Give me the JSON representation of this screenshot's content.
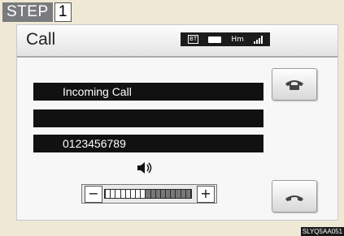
{
  "step": {
    "label": "STEP",
    "number": "1"
  },
  "header": {
    "title": "Call",
    "status": {
      "bluetooth": "BT",
      "hm": "Hm",
      "battery_icon": "battery-icon",
      "signal_icon": "signal-icon"
    }
  },
  "call": {
    "status_text": "Incoming Call",
    "caller_name": "",
    "number": "0123456789"
  },
  "buttons": {
    "answer_icon": "phone-answer-icon",
    "hangup_icon": "phone-hangup-icon"
  },
  "volume": {
    "minus_label": "−",
    "plus_label": "+",
    "level": 0.47,
    "icon": "speaker-icon"
  },
  "footer": {
    "code": "SLYQ5AA051"
  }
}
